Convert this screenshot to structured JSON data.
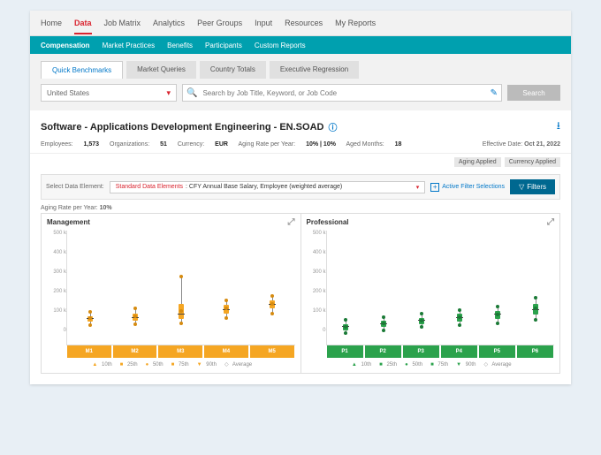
{
  "topnav": [
    "Home",
    "Data",
    "Job Matrix",
    "Analytics",
    "Peer Groups",
    "Input",
    "Resources",
    "My Reports"
  ],
  "subnav": [
    "Compensation",
    "Market Practices",
    "Benefits",
    "Participants",
    "Custom Reports"
  ],
  "tabs": [
    "Quick Benchmarks",
    "Market Queries",
    "Country Totals",
    "Executive Regression"
  ],
  "search": {
    "country": "United States",
    "placeholder": "Search by Job Title, Keyword, or Job Code",
    "button": "Search"
  },
  "title": {
    "text": "Software - Applications Development Engineering - EN.SOAD"
  },
  "meta": {
    "employees_lbl": "Employees:",
    "employees": "1,573",
    "orgs_lbl": "Organizations:",
    "orgs": "51",
    "currency_lbl": "Currency:",
    "currency": "EUR",
    "aging_lbl": "Aging Rate per Year:",
    "aging": "10% | 10%",
    "months_lbl": "Aged Months:",
    "months": "18",
    "eff_lbl": "Effective Date:",
    "eff_date": "Oct 21, 2022"
  },
  "badges": [
    "Aging Applied",
    "Currency Applied"
  ],
  "controls": {
    "label": "Select Data Element:",
    "red": "Standard Data Elements",
    "rest": ": CFY Annual Base Salary, Employee (weighted average)",
    "active_filter": "Active Filter Selections",
    "filters_btn": "Filters"
  },
  "aging_label": {
    "label": "Aging Rate per Year:",
    "value": "10%"
  },
  "legend_items": [
    "10th",
    "25th",
    "50th",
    "75th",
    "90th",
    "Average"
  ],
  "chart_data": [
    {
      "type": "box",
      "title": "Management",
      "categories": [
        "M1",
        "M2",
        "M3",
        "M4",
        "M5"
      ],
      "ylim": [
        0,
        500
      ],
      "yticks": [
        "0",
        "100 k",
        "200 k",
        "300 k",
        "400 k",
        "500 k"
      ],
      "series": [
        {
          "p10": 95,
          "p25": 110,
          "p50": 125,
          "p75": 140,
          "p90": 160,
          "avg": 130
        },
        {
          "p10": 100,
          "p25": 115,
          "p50": 130,
          "p75": 150,
          "p90": 175,
          "avg": 138
        },
        {
          "p10": 105,
          "p25": 125,
          "p50": 145,
          "p75": 200,
          "p90": 330,
          "avg": 165
        },
        {
          "p10": 130,
          "p25": 150,
          "p50": 170,
          "p75": 195,
          "p90": 215,
          "avg": 175
        },
        {
          "p10": 150,
          "p25": 175,
          "p50": 195,
          "p75": 215,
          "p90": 235,
          "avg": 200
        }
      ],
      "color": "#f5a623"
    },
    {
      "type": "box",
      "title": "Professional",
      "categories": [
        "P1",
        "P2",
        "P3",
        "P4",
        "P5",
        "P6"
      ],
      "ylim": [
        0,
        500
      ],
      "yticks": [
        "0",
        "100 k",
        "200 k",
        "300 k",
        "400 k",
        "500 k"
      ],
      "series": [
        {
          "p10": 55,
          "p25": 70,
          "p50": 85,
          "p75": 100,
          "p90": 120,
          "avg": 88
        },
        {
          "p10": 70,
          "p25": 85,
          "p50": 100,
          "p75": 115,
          "p90": 135,
          "avg": 102
        },
        {
          "p10": 85,
          "p25": 100,
          "p50": 115,
          "p75": 130,
          "p90": 150,
          "avg": 118
        },
        {
          "p10": 95,
          "p25": 110,
          "p50": 130,
          "p75": 150,
          "p90": 170,
          "avg": 132
        },
        {
          "p10": 105,
          "p25": 125,
          "p50": 145,
          "p75": 165,
          "p90": 185,
          "avg": 148
        },
        {
          "p10": 120,
          "p25": 145,
          "p50": 170,
          "p75": 200,
          "p90": 230,
          "avg": 175
        }
      ],
      "color": "#2ba24c"
    }
  ]
}
